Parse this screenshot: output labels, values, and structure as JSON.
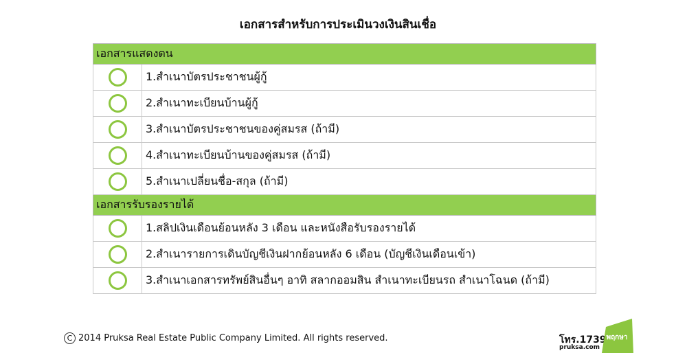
{
  "title": "เอกสารสำหรับการประเมินวงเงินสินเชื่อ",
  "sections": [
    {
      "heading": "เอกสารแสดงตน",
      "items": [
        "1.สำเนาบัตรประชาชนผู้กู้",
        "2.สำเนาทะเบียนบ้านผู้กู้",
        "3.สำเนาบัตรประชาชนของคู่สมรส (ถ้ามี)",
        "4.สำเนาทะเบียนบ้านของคู่สมรส (ถ้ามี)",
        "5.สำเนาเปลี่ยนชื่อ-สกุล (ถ้ามี)"
      ]
    },
    {
      "heading": "เอกสารรับรองรายได้",
      "items": [
        "1.สลิปเงินเดือนย้อนหลัง 3 เดือน และหนังสือรับรองรายได้",
        "2.สำเนารายการเดินบัญชีเงินฝากย้อนหลัง 6 เดือน (บัญชีเงินเดือนเข้า)",
        "3.สำเนาเอกสารทรัพย์สินอื่นๆ อาทิ  สลากออมสิน  สำเนาทะเบียนรถ  สำเนาโฉนด (ถ้ามี)"
      ]
    }
  ],
  "footer": {
    "copyright_symbol": "C",
    "copyright": "2014 Pruksa Real Estate Public Company Limited. All rights reserved."
  },
  "brand": {
    "phone": "โทร.1739",
    "website": "pruksa.com",
    "logo_text": "พฤกษา",
    "logo_color": "#8cc63f"
  },
  "colors": {
    "section_header": "#92cf50",
    "checkbox": "#8cc63f"
  },
  "icons": {
    "checkbox": "circle-checkbox-icon",
    "copyright": "copyright-icon"
  }
}
